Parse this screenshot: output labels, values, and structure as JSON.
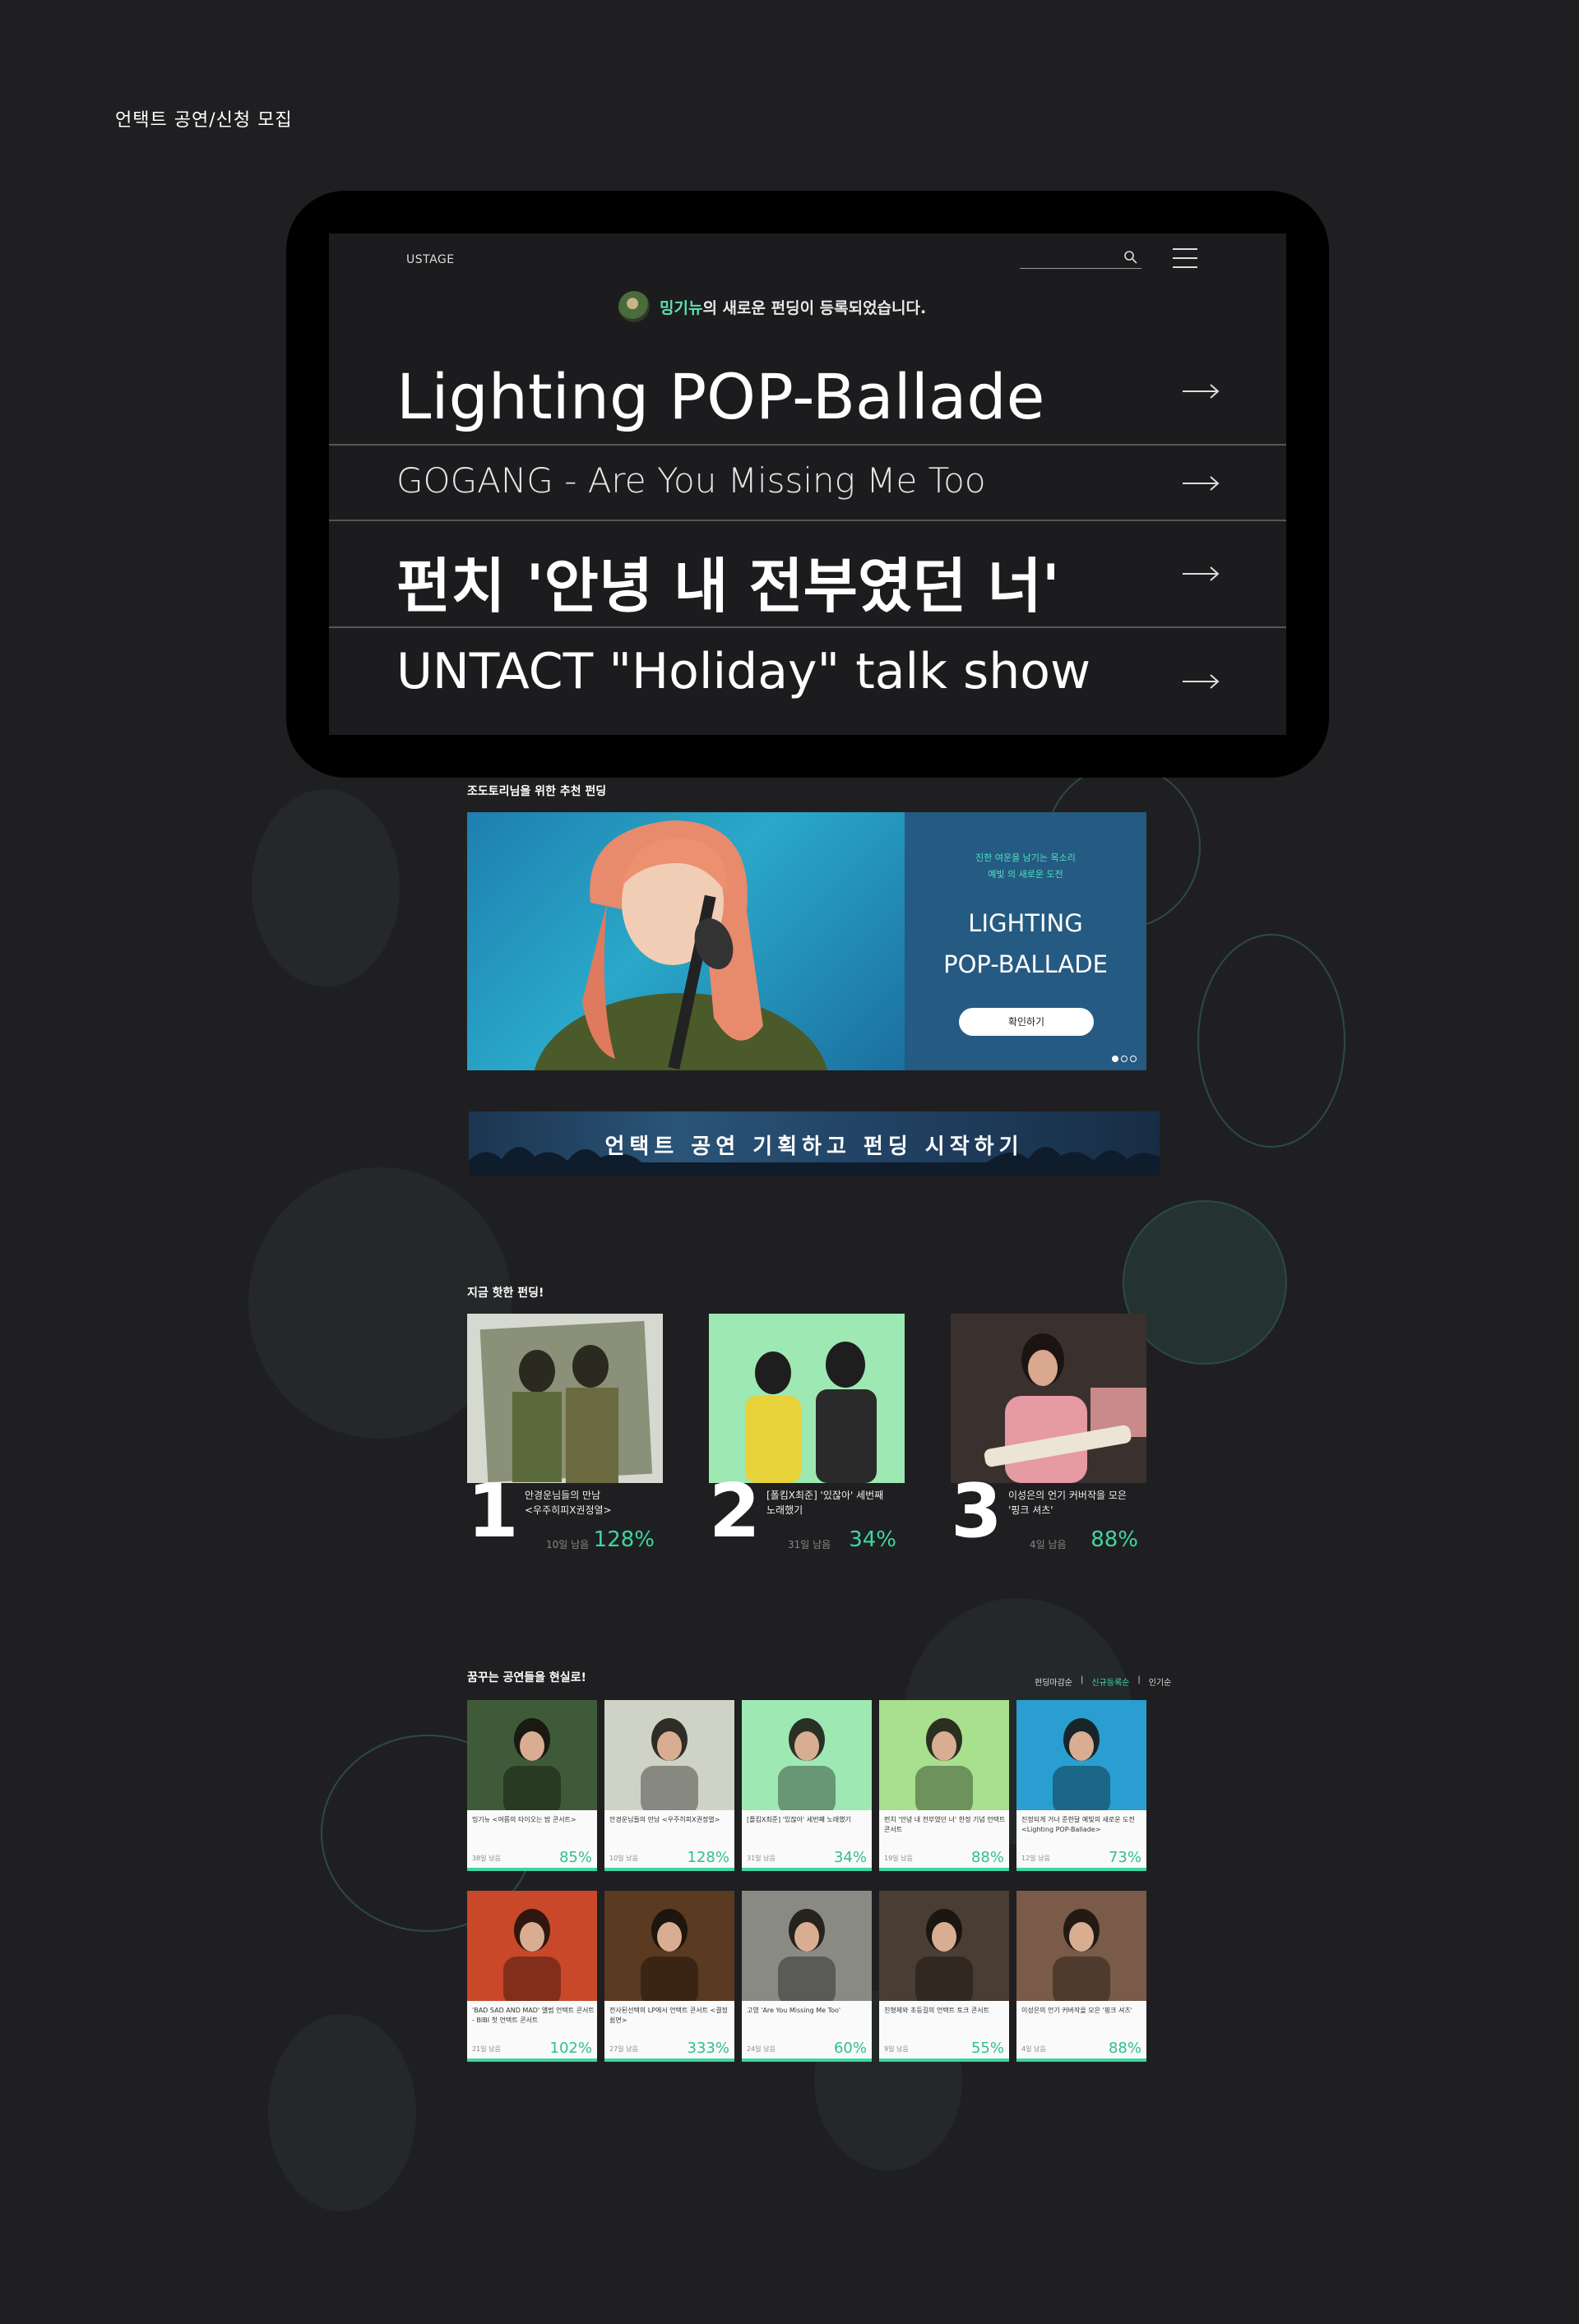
{
  "page": {
    "heading": "언택트 공연/신청 모집"
  },
  "header": {
    "brand": "USTAGE",
    "search_placeholder": "",
    "menu_icon": "hamburger-icon",
    "search_icon": "search-icon"
  },
  "notice": {
    "highlight": "밍기뉴",
    "rest": "의 새로운 펀딩이 등록되었습니다."
  },
  "features": [
    {
      "label": "Lighting POP-Ballade"
    },
    {
      "label": "GOGANG - Are You Missing Me Too"
    },
    {
      "label": "펀치 '안녕 내 전부였던 너'"
    },
    {
      "label": "UNTACT \"Holiday\" talk show"
    }
  ],
  "recommend": {
    "label": "조도토리님을 위한 추천 펀딩",
    "sub_line1": "진한 여운을 남기는 목소리",
    "sub_line2": "예빛 의 새로운 도전",
    "title_line1": "LIGHTING",
    "title_line2": "POP-BALLADE",
    "button": "확인하기"
  },
  "banner": {
    "text": "언택트 공연 기획하고 펀딩 시작하기"
  },
  "hot": {
    "label": "지금 핫한 펀딩!",
    "items": [
      {
        "rank": "1",
        "line1": "안경운님들의 만남",
        "line2": "<우주히피X권정열>",
        "days": "10일 남음",
        "pct": "128%"
      },
      {
        "rank": "2",
        "line1": "[폴킴X최준] '있잖아' 세번째",
        "line2": "노래했기",
        "days": "31일 남음",
        "pct": "34%"
      },
      {
        "rank": "3",
        "line1": "이성은의 언기 커버작을 모은",
        "line2": "'핑크 셔츠'",
        "days": "4일 남음",
        "pct": "88%"
      }
    ]
  },
  "dream": {
    "label": "꿈꾸는 공연들을 현실로!",
    "tabs": [
      "펀딩마감순",
      "신규등록순",
      "인기순"
    ],
    "active_tab": 1,
    "cards": [
      {
        "cap": "밍기뉴 <여름의 타이오는 밤 콘서트>",
        "days": "38일 남음",
        "pct": "85%"
      },
      {
        "cap": "안경운님들의 만남 <우주히피X권정열>",
        "days": "10일 남음",
        "pct": "128%"
      },
      {
        "cap": "[폴킴X최준] '있잖아' 세번째 노래했기",
        "days": "31일 남음",
        "pct": "34%"
      },
      {
        "cap": "펀치 '안녕 내 전부였던 너' 한정 기념 언택트 콘서트",
        "days": "19일 남음",
        "pct": "88%"
      },
      {
        "cap": "진정되게 거너 준한달 예빛의 새로운 도전 <Lighting POP-Ballade>",
        "days": "12일 남음",
        "pct": "73%"
      },
      {
        "cap": "'BAD SAD AND MAD' 앨범 언택트 콘서트 - BIBI 첫 언택트 콘서트",
        "days": "21일 남음",
        "pct": "102%"
      },
      {
        "cap": "전사된선택의 LP에서 언택트 콘서트 <결정쉼면>",
        "days": "27일 남음",
        "pct": "333%"
      },
      {
        "cap": "고영 'Are You Missing Me Too'",
        "days": "24일 남음",
        "pct": "60%"
      },
      {
        "cap": "친형제와 초등길의 언택트 토크 콘서트",
        "days": "9일 남음",
        "pct": "55%"
      },
      {
        "cap": "이성은의 언기 커버작을 모은 '핑크 셔츠'",
        "days": "4일 남음",
        "pct": "88%"
      }
    ]
  },
  "colors": {
    "background": "#1f1f21",
    "accent": "#3ed6a3",
    "panel": "#255a82"
  }
}
